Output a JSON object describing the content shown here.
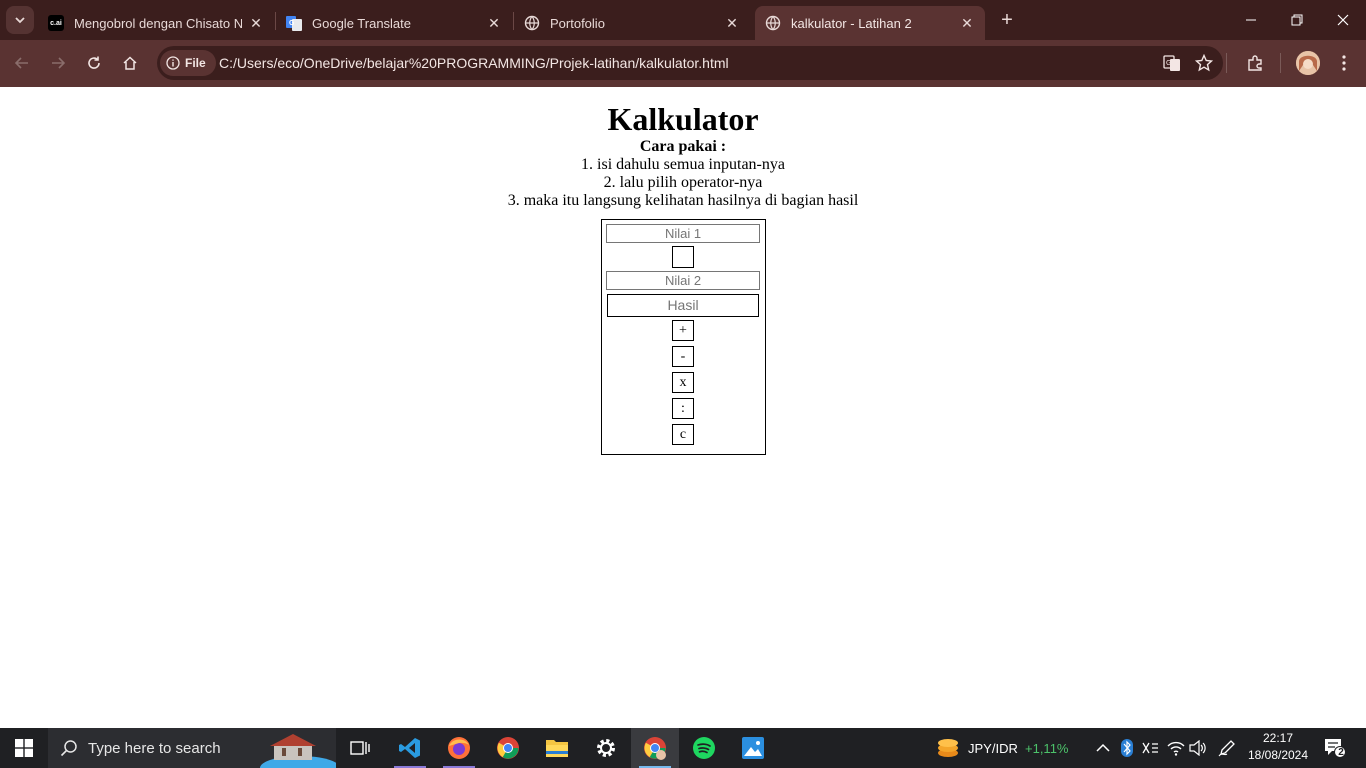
{
  "browser": {
    "tabs": [
      {
        "title": "Mengobrol dengan Chisato Nishikigi",
        "favicon": "c.ai",
        "active": false
      },
      {
        "title": "Google Translate",
        "favicon": "google-translate-icon",
        "active": false
      },
      {
        "title": "Portofolio",
        "favicon": "globe-icon",
        "active": false
      },
      {
        "title": "kalkulator - Latihan 2",
        "favicon": "globe-icon",
        "active": true
      }
    ],
    "site_chip": "File",
    "url": "C:/Users/eco/OneDrive/belajar%20PROGRAMMING/Projek-latihan/kalkulator.html"
  },
  "page": {
    "title": "Kalkulator",
    "howto_heading": "Cara pakai :",
    "steps": [
      "1. isi dahulu semua inputan-nya",
      "2. lalu pilih operator-nya",
      "3. maka itu langsung kelihatan hasilnya di bagian hasil"
    ],
    "calculator": {
      "input1_placeholder": "Nilai 1",
      "operator_value": "",
      "input2_placeholder": "Nilai 2",
      "result_placeholder": "Hasil",
      "buttons": [
        "+",
        "-",
        "x",
        ":",
        "c"
      ]
    }
  },
  "taskbar": {
    "search_placeholder": "Type here to search",
    "stock_ticker": "JPY/IDR",
    "stock_change": "+1,11%",
    "time": "22:17",
    "date": "18/08/2024",
    "notification_count": "2"
  },
  "colors": {
    "chrome_dark": "#3b1e1d",
    "chrome_toolbar": "#5a3332",
    "taskbar": "#1f2023",
    "stock_up": "#4cc26a"
  }
}
